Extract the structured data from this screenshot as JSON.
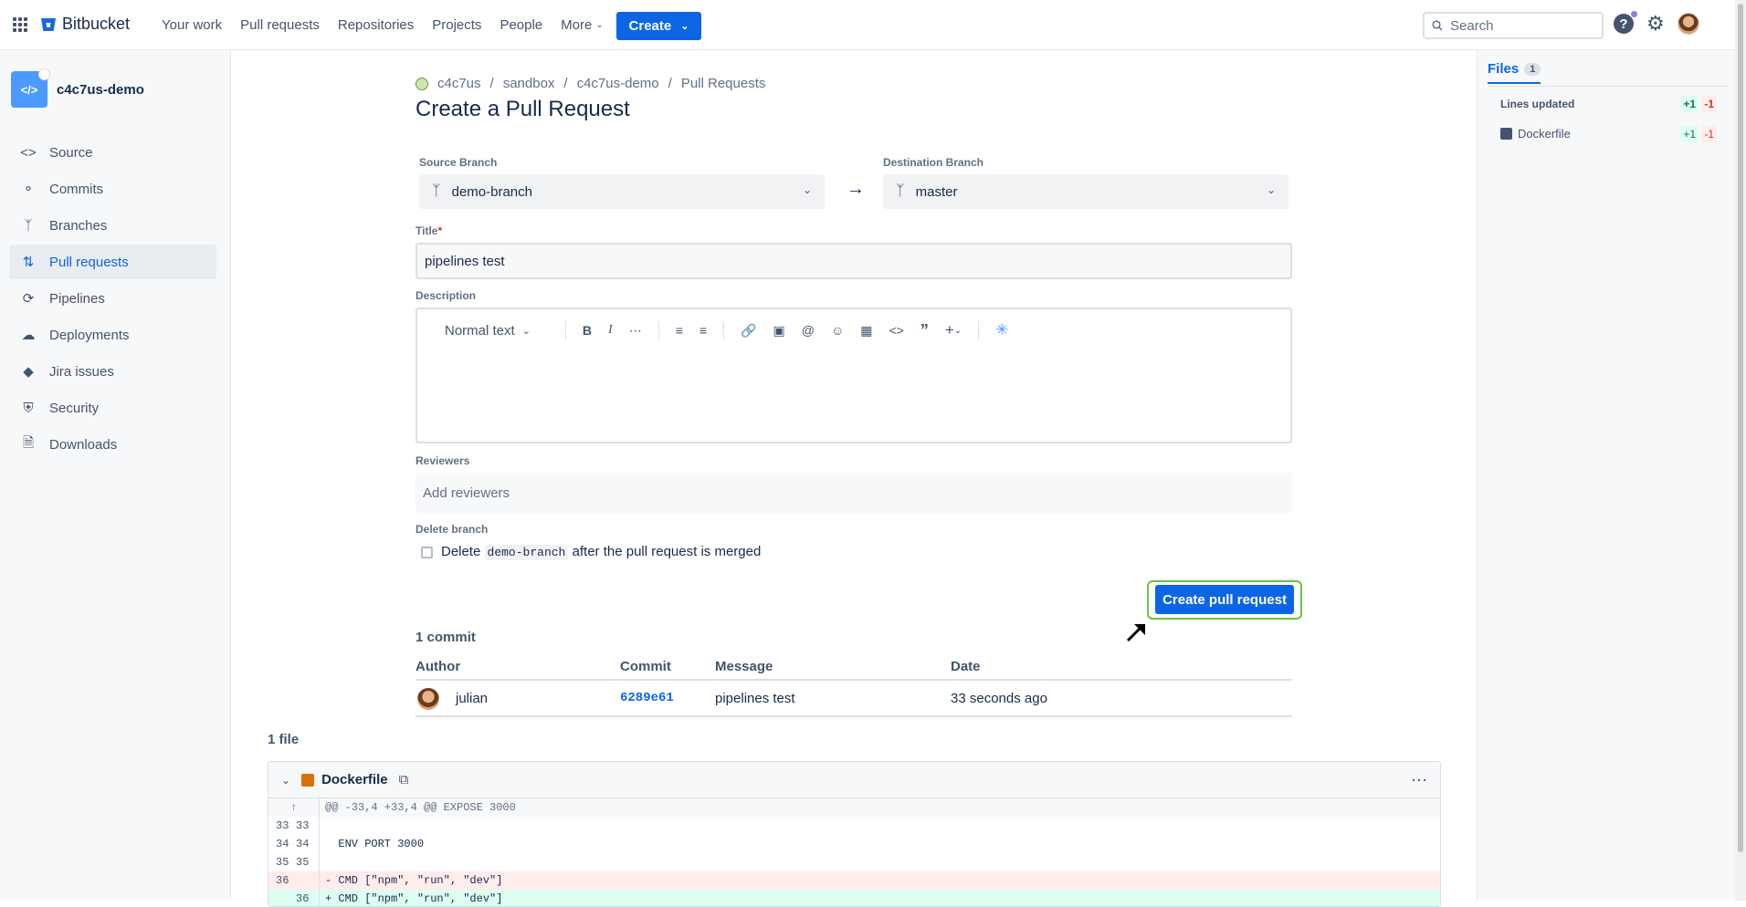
{
  "topbar": {
    "brand": "Bitbucket",
    "nav": [
      "Your work",
      "Pull requests",
      "Repositories",
      "Projects",
      "People",
      "More"
    ],
    "create_label": "Create",
    "search_placeholder": "Search",
    "help_label": "?"
  },
  "sidebar": {
    "repo_name": "c4c7us-demo",
    "repo_avatar": "</>",
    "items": [
      {
        "label": "Source",
        "icon": "code-icon"
      },
      {
        "label": "Commits",
        "icon": "commit-icon"
      },
      {
        "label": "Branches",
        "icon": "branch-icon"
      },
      {
        "label": "Pull requests",
        "icon": "pull-request-icon",
        "active": true
      },
      {
        "label": "Pipelines",
        "icon": "pipelines-icon"
      },
      {
        "label": "Deployments",
        "icon": "deployments-icon"
      },
      {
        "label": "Jira issues",
        "icon": "jira-icon"
      },
      {
        "label": "Security",
        "icon": "shield-icon"
      },
      {
        "label": "Downloads",
        "icon": "file-icon"
      }
    ]
  },
  "breadcrumb": [
    "c4c7us",
    "sandbox",
    "c4c7us-demo",
    "Pull Requests"
  ],
  "page_title": "Create a Pull Request",
  "form": {
    "source_label": "Source Branch",
    "source_value": "demo-branch",
    "dest_label": "Destination Branch",
    "dest_value": "master",
    "title_label": "Title",
    "title_required": "*",
    "title_value": "pipelines test",
    "description_label": "Description",
    "text_style": "Normal text",
    "reviewers_label": "Reviewers",
    "reviewers_placeholder": "Add reviewers",
    "delete_label": "Delete branch",
    "delete_prefix": "Delete",
    "delete_branch": "demo-branch",
    "delete_suffix": "after the pull request is merged",
    "submit_label": "Create pull request"
  },
  "commits": {
    "count_label": "1 commit",
    "headers": [
      "Author",
      "Commit",
      "Message",
      "Date"
    ],
    "rows": [
      {
        "author": "julian",
        "commit": "6289e61",
        "message": "pipelines test",
        "date": "33 seconds ago"
      }
    ]
  },
  "files": {
    "count_label": "1 file",
    "file_name": "Dockerfile",
    "hunk": "@@ -33,4 +33,4 @@ EXPOSE 3000",
    "lines": [
      {
        "old": "33",
        "new": "33",
        "text": ""
      },
      {
        "old": "34",
        "new": "34",
        "text": "  ENV PORT 3000"
      },
      {
        "old": "35",
        "new": "35",
        "text": ""
      },
      {
        "old": "36",
        "new": "",
        "text": "- CMD [\"npm\", \"run\", \"dev\"]",
        "type": "del"
      },
      {
        "old": "",
        "new": "36",
        "text": "+ CMD [\"npm\", \"run\", \"dev\"]",
        "type": "add"
      }
    ]
  },
  "right_panel": {
    "tab_label": "Files",
    "tab_count": "1",
    "summary_label": "Lines updated",
    "summary_add": "+1",
    "summary_del": "-1",
    "file_name": "Dockerfile",
    "file_add": "+1",
    "file_del": "-1"
  },
  "colors": {
    "accent": "#0c66e4",
    "highlight": "#6cc24a"
  }
}
